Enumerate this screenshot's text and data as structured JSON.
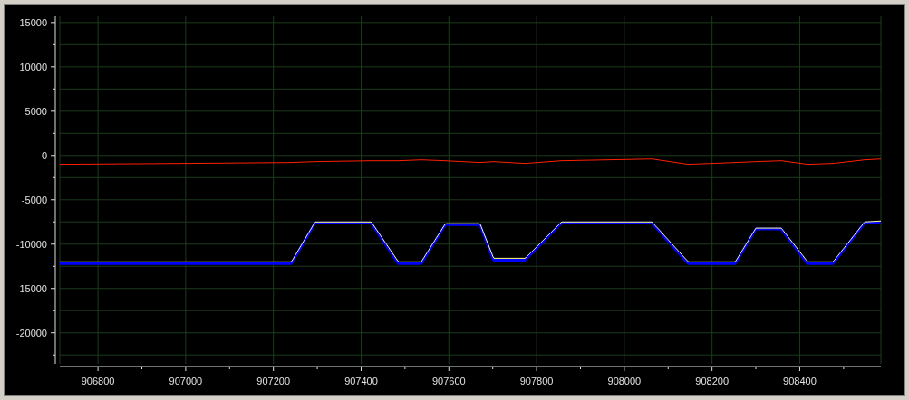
{
  "chart_data": {
    "type": "line",
    "xlim": [
      906713,
      908585
    ],
    "ylim": [
      -23500,
      15700
    ],
    "grid": true,
    "xticks": [
      906800,
      907000,
      907200,
      907400,
      907600,
      907800,
      908000,
      908200,
      908400
    ],
    "yticks": [
      15000,
      10000,
      5000,
      0,
      -5000,
      -10000,
      -15000,
      -20000
    ],
    "x": [
      906713,
      907000,
      907241,
      907295,
      907423,
      907485,
      907537,
      907592,
      907671,
      907702,
      907774,
      907857,
      908063,
      908146,
      908253,
      908300,
      908358,
      908418,
      908476,
      908548,
      908585
    ],
    "series": [
      {
        "color": "#ff2000",
        "values": [
          -1000,
          -900,
          -800,
          -700,
          -600,
          -600,
          -500,
          -600,
          -800,
          -700,
          -900,
          -600,
          -400,
          -1000,
          -800,
          -700,
          -600,
          -1000,
          -900,
          -500,
          -400
        ]
      },
      {
        "color": "#0000ff",
        "values": [
          -12200,
          -12200,
          -12200,
          -7600,
          -7600,
          -12200,
          -12200,
          -7800,
          -7800,
          -11800,
          -11800,
          -7600,
          -7600,
          -12200,
          -12200,
          -8300,
          -8300,
          -12200,
          -12200,
          -7600,
          -7500
        ]
      },
      {
        "color": "#ffff80",
        "values": [
          -12000,
          -12000,
          -12000,
          -7500,
          -7500,
          -12000,
          -12000,
          -7700,
          -7700,
          -11600,
          -11600,
          -7500,
          -7500,
          -12000,
          -12000,
          -8200,
          -8200,
          -12000,
          -12000,
          -7500,
          -7400
        ]
      }
    ]
  }
}
